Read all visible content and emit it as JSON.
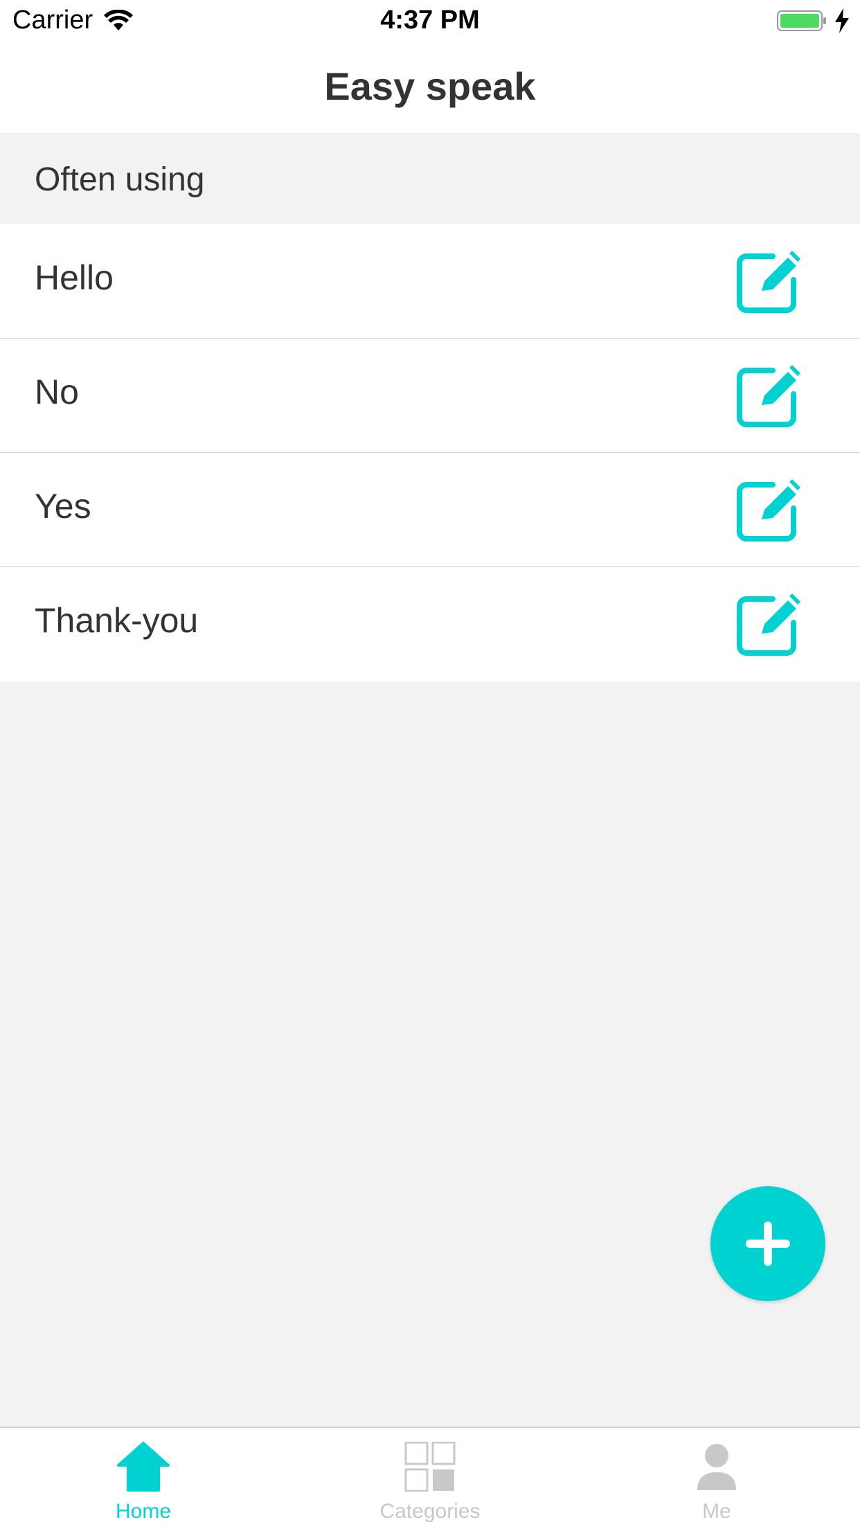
{
  "status_bar": {
    "carrier": "Carrier",
    "time": "4:37 PM"
  },
  "nav": {
    "title": "Easy speak"
  },
  "section": {
    "header": "Often using"
  },
  "phrases": [
    {
      "label": "Hello"
    },
    {
      "label": "No"
    },
    {
      "label": "Yes"
    },
    {
      "label": "Thank-you"
    }
  ],
  "tabs": [
    {
      "label": "Home",
      "icon": "home-icon",
      "active": true
    },
    {
      "label": "Categories",
      "icon": "grid-icon",
      "active": false
    },
    {
      "label": "Me",
      "icon": "person-icon",
      "active": false
    }
  ],
  "colors": {
    "accent": "#00d2d2",
    "inactive": "#c8c8c8",
    "background": "#f2f2f2"
  }
}
